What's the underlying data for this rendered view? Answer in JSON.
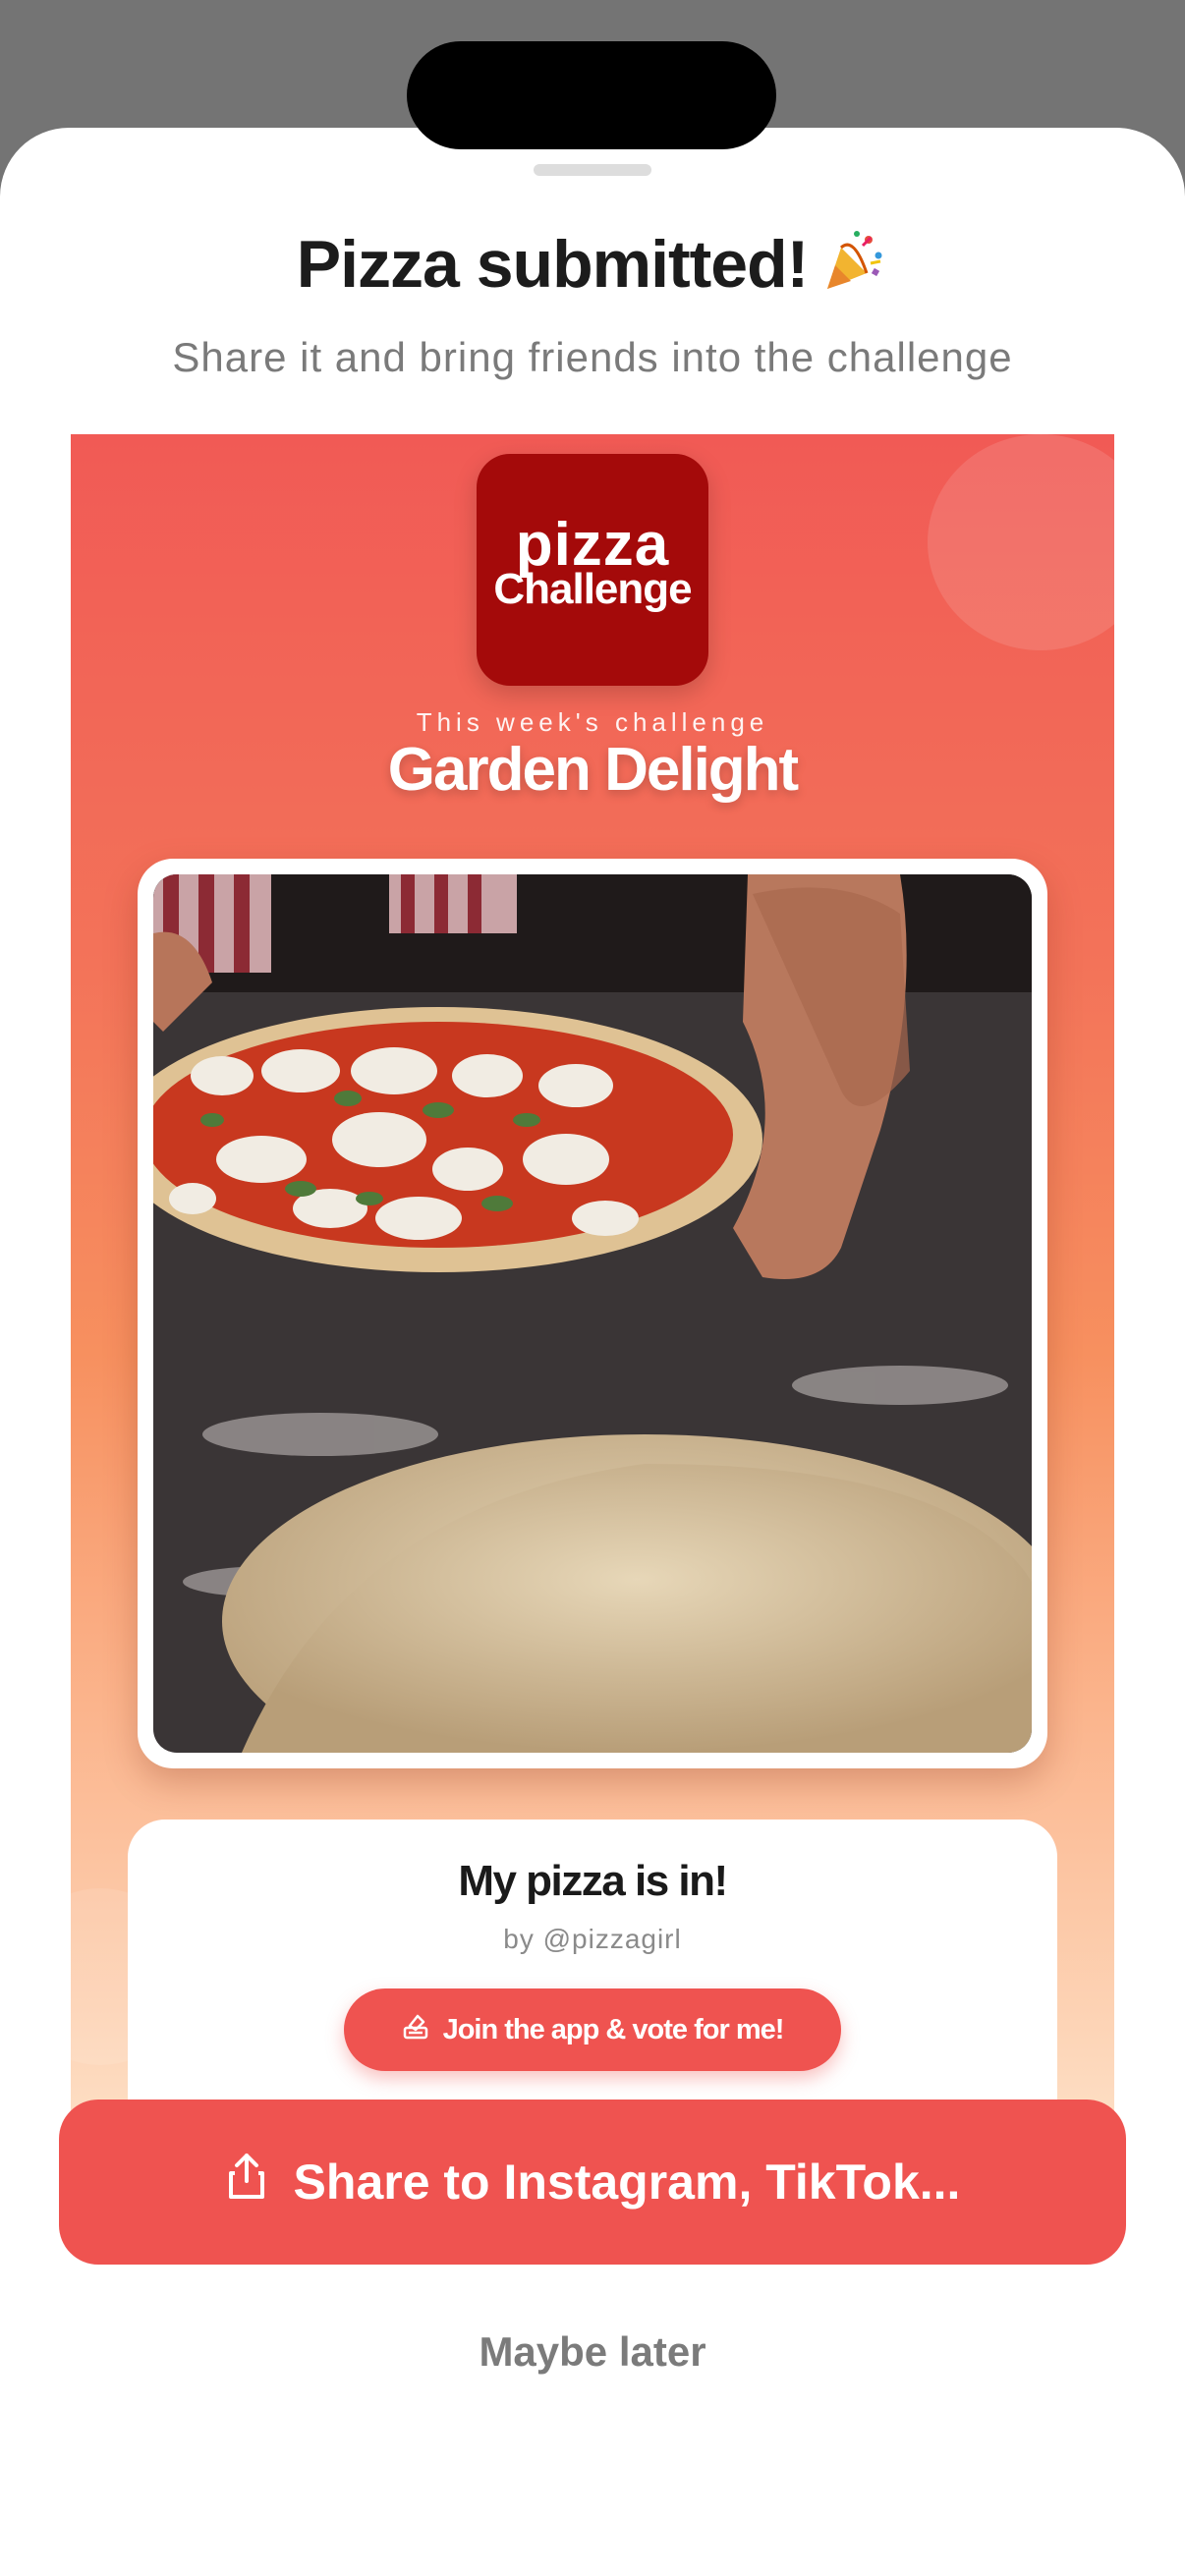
{
  "modal": {
    "title": "Pizza submitted!",
    "subtitle": "Share it and bring friends into the challenge"
  },
  "card": {
    "logo": {
      "line1": "pizza",
      "line2": "Challenge"
    },
    "week_label": "This week's challenge",
    "challenge_name": "Garden Delight",
    "photo_description": "pizza-photo",
    "post_title": "My pizza is in!",
    "author": "by @pizzagirl",
    "vote_label": "Join the app & vote for me!"
  },
  "actions": {
    "share_label": "Share to Instagram, TikTok...",
    "later_label": "Maybe later"
  },
  "colors": {
    "accent": "#ef5350",
    "logo_bg": "#a40a0a",
    "card_top": "#f15a55",
    "card_bottom": "#fde7d0"
  }
}
